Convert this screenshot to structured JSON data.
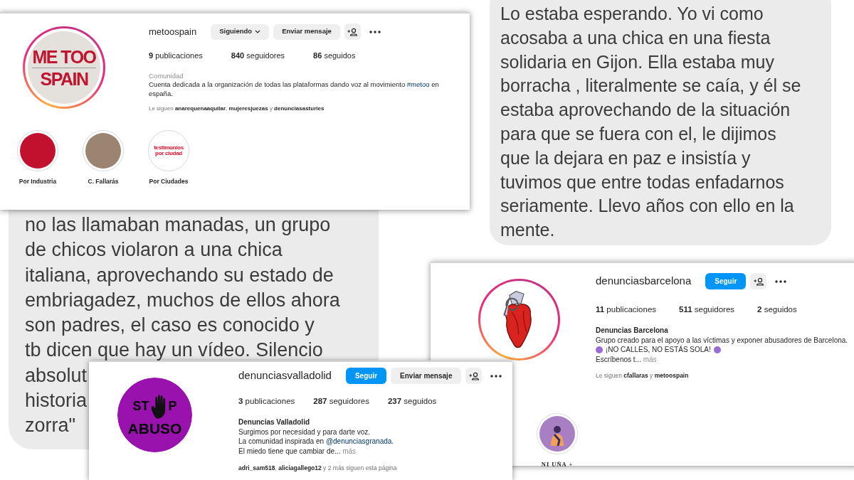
{
  "chat_bubbles": [
    {
      "lines": [
        "no las llamaban manadas, un grupo",
        "de chicos violaron a una chica",
        "italiana, aprovechando su estado de",
        "embriagadez, muchos de ellos ahora",
        "son padres, el caso es conocido y",
        "tb dicen que hay un vídeo. Silencio",
        "absolut",
        "historia",
        "zorra\""
      ]
    },
    {
      "lines": [
        "Lo estaba esperando. Yo vi como",
        "acosaba a una chica en una fiesta",
        "solidaria en Gijon. Ella estaba muy",
        "borracha , literalmente se caía, y él se",
        "estaba aprovechando de la situación",
        "para que se fuera con el, le dijimos",
        "que la dejara en paz e insistía y",
        "tuvimos que entre todas enfadarnos",
        "seriamente. Llevo años con ello en la",
        "mente."
      ]
    }
  ],
  "profiles": [
    {
      "username": "metoospain",
      "avatar": {
        "kind": "text-logo",
        "lines": [
          "ME TOO",
          "SPAIN"
        ]
      },
      "story_ring": true,
      "buttons": [
        {
          "kind": "following",
          "label": "Siguiendo"
        },
        {
          "kind": "secondary",
          "label": "Enviar mensaje"
        }
      ],
      "stats": [
        "**9** publicaciones",
        "**840** seguidores",
        "**86** seguidos"
      ],
      "category": "Comunidad",
      "bio": [
        {
          "parts": [
            {
              "kind": "text",
              "text": "Cuenta dedicada a la organización de todas las plataformas dando voz al movimiento "
            },
            {
              "kind": "link",
              "text": "#metoo"
            },
            {
              "kind": "text",
              "text": " en españa."
            }
          ]
        }
      ],
      "followed_by": "Le siguen **anarequenaaquilar**, **mujeresjuezas** y **denunciasasturies**",
      "highlights": [
        {
          "kind": "solid",
          "label": "Por Industria"
        },
        {
          "kind": "photo",
          "label": "C. Fallarás"
        },
        {
          "kind": "text-cover",
          "cover_text": "testimonios por ciudad",
          "label": "Por Ciudades"
        }
      ]
    },
    {
      "username": "denunciasbarcelona",
      "avatar": {
        "kind": "heart-drawing"
      },
      "story_ring": true,
      "buttons": [
        {
          "kind": "primary",
          "label": "Seguir"
        }
      ],
      "stats": [
        "**11** publicaciones",
        "**511** seguidores",
        "**2** seguidos"
      ],
      "display_name": "Denuncias Barcelona",
      "bio": [
        {
          "parts": [
            {
              "kind": "text",
              "text": "Grupo creado para el apoyo a las víctimas y exponer abusadores de Barcelona."
            }
          ]
        },
        {
          "parts": [
            {
              "kind": "dot"
            },
            {
              "kind": "text",
              "text": "¡NO CALLES, NO ESTÁS SOLA!"
            },
            {
              "kind": "dot"
            }
          ]
        },
        {
          "parts": [
            {
              "kind": "text",
              "text": "Escríbenos t... "
            },
            {
              "kind": "more",
              "text": "más"
            }
          ]
        }
      ],
      "followed_by": "Le siguen **cfallaras** y **metoospain**",
      "highlights": [
        {
          "kind": "illustration",
          "label": "NI UÑA +"
        }
      ]
    },
    {
      "username": "denunciasvalladolid",
      "avatar": {
        "kind": "stop-logo",
        "lines": [
          "ST",
          "P",
          "ABUSO"
        ]
      },
      "story_ring": false,
      "buttons": [
        {
          "kind": "primary",
          "label": "Seguir"
        },
        {
          "kind": "secondary",
          "label": "Enviar mensaje"
        }
      ],
      "stats": [
        "**3** publicaciones",
        "**287** seguidores",
        "**237** seguidos"
      ],
      "display_name": "Denuncias Valladolid",
      "bio": [
        {
          "parts": [
            {
              "kind": "text",
              "text": "Surgimos por necesidad y para darte voz."
            }
          ]
        },
        {
          "parts": [
            {
              "kind": "text",
              "text": "La comunidad inspirada en "
            },
            {
              "kind": "link",
              "text": "@denunciasgranada"
            },
            {
              "kind": "text",
              "text": "."
            }
          ]
        },
        {
          "parts": [
            {
              "kind": "text",
              "text": "El miedo tiene que cambiar de... "
            },
            {
              "kind": "more",
              "text": "más"
            }
          ]
        }
      ],
      "followed_by": "**adri_sam518**, **aliciagallego12** y 2 más siguen esta página"
    }
  ]
}
